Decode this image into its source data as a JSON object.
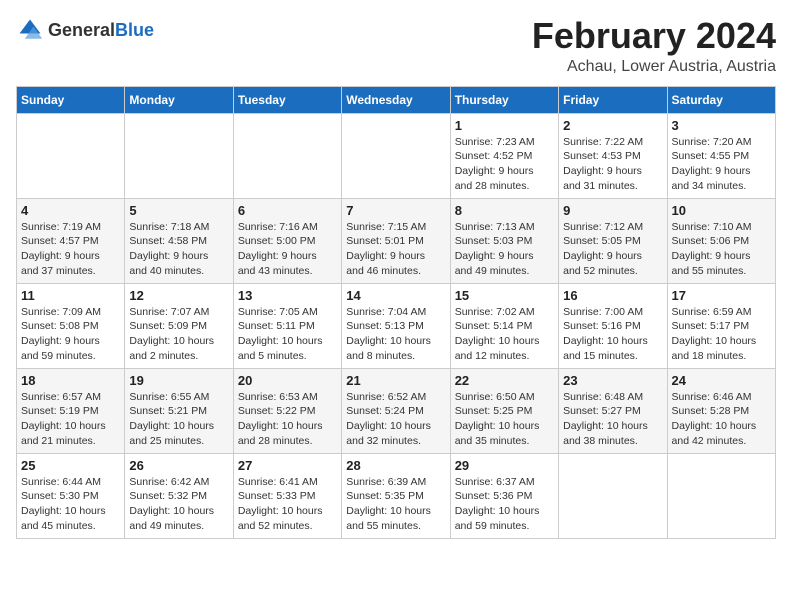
{
  "logo": {
    "text_general": "General",
    "text_blue": "Blue"
  },
  "title": {
    "month": "February 2024",
    "location": "Achau, Lower Austria, Austria"
  },
  "headers": [
    "Sunday",
    "Monday",
    "Tuesday",
    "Wednesday",
    "Thursday",
    "Friday",
    "Saturday"
  ],
  "weeks": [
    [
      {
        "day": "",
        "details": "",
        "empty": true
      },
      {
        "day": "",
        "details": "",
        "empty": true
      },
      {
        "day": "",
        "details": "",
        "empty": true
      },
      {
        "day": "",
        "details": "",
        "empty": true
      },
      {
        "day": "1",
        "details": "Sunrise: 7:23 AM\nSunset: 4:52 PM\nDaylight: 9 hours\nand 28 minutes.",
        "empty": false
      },
      {
        "day": "2",
        "details": "Sunrise: 7:22 AM\nSunset: 4:53 PM\nDaylight: 9 hours\nand 31 minutes.",
        "empty": false
      },
      {
        "day": "3",
        "details": "Sunrise: 7:20 AM\nSunset: 4:55 PM\nDaylight: 9 hours\nand 34 minutes.",
        "empty": false
      }
    ],
    [
      {
        "day": "4",
        "details": "Sunrise: 7:19 AM\nSunset: 4:57 PM\nDaylight: 9 hours\nand 37 minutes.",
        "empty": false
      },
      {
        "day": "5",
        "details": "Sunrise: 7:18 AM\nSunset: 4:58 PM\nDaylight: 9 hours\nand 40 minutes.",
        "empty": false
      },
      {
        "day": "6",
        "details": "Sunrise: 7:16 AM\nSunset: 5:00 PM\nDaylight: 9 hours\nand 43 minutes.",
        "empty": false
      },
      {
        "day": "7",
        "details": "Sunrise: 7:15 AM\nSunset: 5:01 PM\nDaylight: 9 hours\nand 46 minutes.",
        "empty": false
      },
      {
        "day": "8",
        "details": "Sunrise: 7:13 AM\nSunset: 5:03 PM\nDaylight: 9 hours\nand 49 minutes.",
        "empty": false
      },
      {
        "day": "9",
        "details": "Sunrise: 7:12 AM\nSunset: 5:05 PM\nDaylight: 9 hours\nand 52 minutes.",
        "empty": false
      },
      {
        "day": "10",
        "details": "Sunrise: 7:10 AM\nSunset: 5:06 PM\nDaylight: 9 hours\nand 55 minutes.",
        "empty": false
      }
    ],
    [
      {
        "day": "11",
        "details": "Sunrise: 7:09 AM\nSunset: 5:08 PM\nDaylight: 9 hours\nand 59 minutes.",
        "empty": false
      },
      {
        "day": "12",
        "details": "Sunrise: 7:07 AM\nSunset: 5:09 PM\nDaylight: 10 hours\nand 2 minutes.",
        "empty": false
      },
      {
        "day": "13",
        "details": "Sunrise: 7:05 AM\nSunset: 5:11 PM\nDaylight: 10 hours\nand 5 minutes.",
        "empty": false
      },
      {
        "day": "14",
        "details": "Sunrise: 7:04 AM\nSunset: 5:13 PM\nDaylight: 10 hours\nand 8 minutes.",
        "empty": false
      },
      {
        "day": "15",
        "details": "Sunrise: 7:02 AM\nSunset: 5:14 PM\nDaylight: 10 hours\nand 12 minutes.",
        "empty": false
      },
      {
        "day": "16",
        "details": "Sunrise: 7:00 AM\nSunset: 5:16 PM\nDaylight: 10 hours\nand 15 minutes.",
        "empty": false
      },
      {
        "day": "17",
        "details": "Sunrise: 6:59 AM\nSunset: 5:17 PM\nDaylight: 10 hours\nand 18 minutes.",
        "empty": false
      }
    ],
    [
      {
        "day": "18",
        "details": "Sunrise: 6:57 AM\nSunset: 5:19 PM\nDaylight: 10 hours\nand 21 minutes.",
        "empty": false
      },
      {
        "day": "19",
        "details": "Sunrise: 6:55 AM\nSunset: 5:21 PM\nDaylight: 10 hours\nand 25 minutes.",
        "empty": false
      },
      {
        "day": "20",
        "details": "Sunrise: 6:53 AM\nSunset: 5:22 PM\nDaylight: 10 hours\nand 28 minutes.",
        "empty": false
      },
      {
        "day": "21",
        "details": "Sunrise: 6:52 AM\nSunset: 5:24 PM\nDaylight: 10 hours\nand 32 minutes.",
        "empty": false
      },
      {
        "day": "22",
        "details": "Sunrise: 6:50 AM\nSunset: 5:25 PM\nDaylight: 10 hours\nand 35 minutes.",
        "empty": false
      },
      {
        "day": "23",
        "details": "Sunrise: 6:48 AM\nSunset: 5:27 PM\nDaylight: 10 hours\nand 38 minutes.",
        "empty": false
      },
      {
        "day": "24",
        "details": "Sunrise: 6:46 AM\nSunset: 5:28 PM\nDaylight: 10 hours\nand 42 minutes.",
        "empty": false
      }
    ],
    [
      {
        "day": "25",
        "details": "Sunrise: 6:44 AM\nSunset: 5:30 PM\nDaylight: 10 hours\nand 45 minutes.",
        "empty": false
      },
      {
        "day": "26",
        "details": "Sunrise: 6:42 AM\nSunset: 5:32 PM\nDaylight: 10 hours\nand 49 minutes.",
        "empty": false
      },
      {
        "day": "27",
        "details": "Sunrise: 6:41 AM\nSunset: 5:33 PM\nDaylight: 10 hours\nand 52 minutes.",
        "empty": false
      },
      {
        "day": "28",
        "details": "Sunrise: 6:39 AM\nSunset: 5:35 PM\nDaylight: 10 hours\nand 55 minutes.",
        "empty": false
      },
      {
        "day": "29",
        "details": "Sunrise: 6:37 AM\nSunset: 5:36 PM\nDaylight: 10 hours\nand 59 minutes.",
        "empty": false
      },
      {
        "day": "",
        "details": "",
        "empty": true
      },
      {
        "day": "",
        "details": "",
        "empty": true
      }
    ]
  ]
}
